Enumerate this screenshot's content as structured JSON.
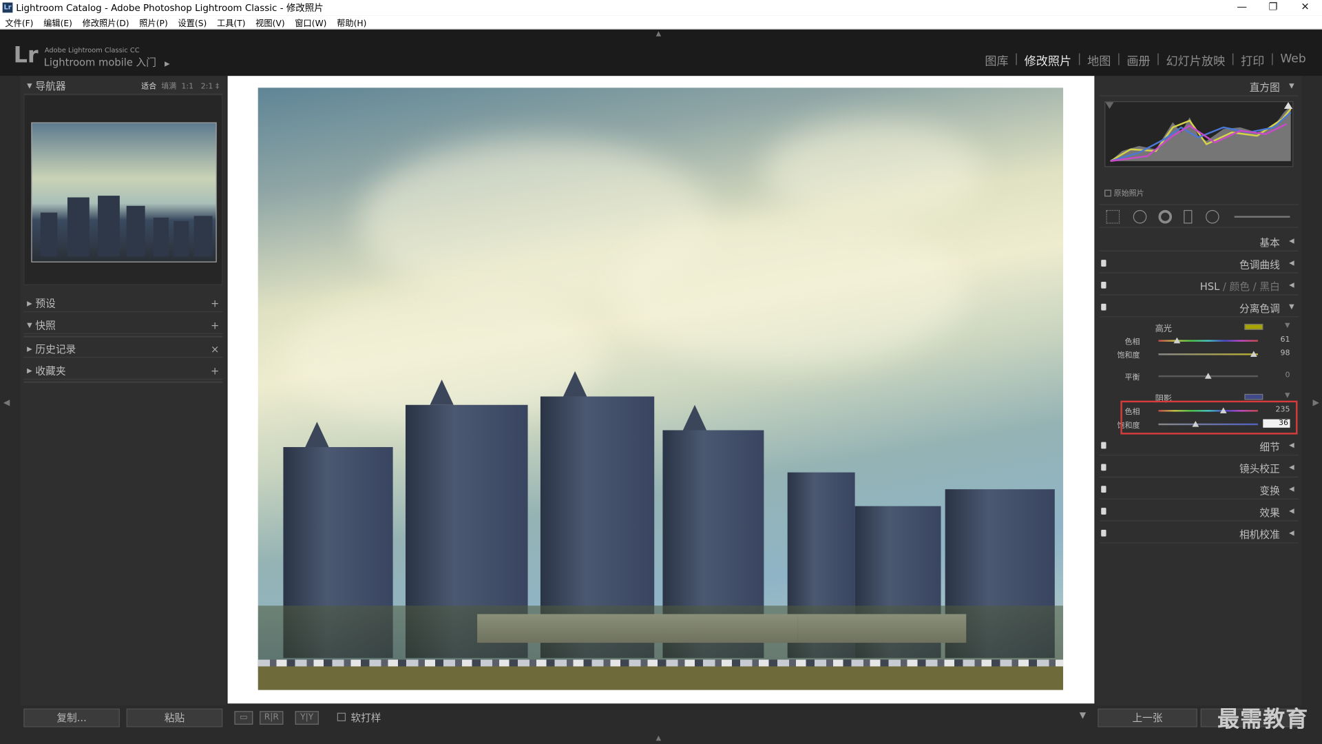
{
  "window": {
    "title": "Lightroom Catalog - Adobe Photoshop Lightroom Classic - 修改照片",
    "app_icon": "Lr",
    "controls": [
      "—",
      "❐",
      "✕"
    ]
  },
  "menu": [
    "文件(F)",
    "编辑(E)",
    "修改照片(D)",
    "照片(P)",
    "设置(S)",
    "工具(T)",
    "视图(V)",
    "窗口(W)",
    "帮助(H)"
  ],
  "identity": {
    "logo": "Lr",
    "line1": "Adobe Lightroom Classic CC",
    "line2": "Lightroom mobile 入门",
    "arrow": "▶"
  },
  "modules": {
    "library": "图库",
    "develop": "修改照片",
    "map": "地图",
    "book": "画册",
    "slideshow": "幻灯片放映",
    "print": "打印",
    "web": "Web",
    "separator": "|"
  },
  "left": {
    "navigator": {
      "title": "导航器",
      "fit": "适合",
      "fill": "填满",
      "z1": "1:1",
      "z2": "2:1",
      "z_more": "‡"
    },
    "presets": "预设",
    "snapshots": "快照",
    "history": "历史记录",
    "collections": "收藏夹",
    "plus": "+",
    "close": "×",
    "copy_btn": "复制...",
    "paste_btn": "粘贴"
  },
  "toolbar": {
    "view1": "▭",
    "view2": "R|R",
    "view3": "Y|Y",
    "soft_proof": "软打样",
    "menu_arrow": "▼"
  },
  "right": {
    "histogram": "直方图",
    "original_photo": "原始照片",
    "basic": "基本",
    "tone_curve": "色调曲线",
    "hsl": "HSL",
    "color": "颜色",
    "bw": "黑白",
    "slash": "/",
    "split_toning": "分离色调",
    "highlights": "高光",
    "shadows": "阴影",
    "hue": "色相",
    "saturation": "饱和度",
    "balance": "平衡",
    "hl_hue": "61",
    "hl_sat": "98",
    "bal_val": "0",
    "sh_hue": "235",
    "sh_sat": "36",
    "detail": "细节",
    "lens": "镜头校正",
    "transform": "变换",
    "effects": "效果",
    "calibration": "相机校准",
    "prev_btn": "上一张"
  },
  "slider_levels": {
    "hl_hue": 0.19,
    "hl_sat": 0.96,
    "balance": 0.5,
    "sh_hue": 0.65,
    "sh_sat": 0.37
  },
  "colors": {
    "highlight_chip": "#a8a400",
    "shadow_chip": "#404a8a",
    "annotation_red": "#d83b3b"
  },
  "watermark": "最需教育"
}
